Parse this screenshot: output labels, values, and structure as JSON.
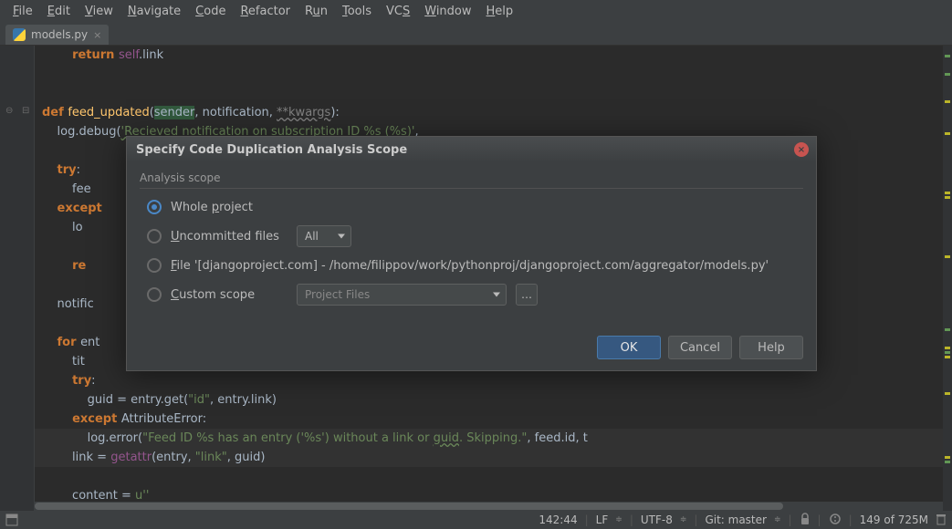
{
  "menu": [
    "File",
    "Edit",
    "View",
    "Navigate",
    "Code",
    "Refactor",
    "Run",
    "Tools",
    "VCS",
    "Window",
    "Help"
  ],
  "menu_accel": [
    0,
    0,
    0,
    0,
    0,
    0,
    1,
    0,
    2,
    0,
    0
  ],
  "tab": {
    "label": "models.py"
  },
  "lines": [
    {
      "i": 8,
      "html": "<span class='k-orange'>return </span><span class='self'>self</span>.link"
    },
    {
      "i": 0,
      "html": ""
    },
    {
      "i": 0,
      "html": ""
    },
    {
      "i": 0,
      "fold": "⊟",
      "caret": "⊖",
      "html": "<span class='k-def'>def </span><span class='name-fn'>feed_updated</span>(<span class='sender-hl'>sender</span>, notification, <span class='pale under-wave'>**kwargs</span>):"
    },
    {
      "i": 4,
      "html": "log.debug(<span class='str under-wave2'>'Recieved notification on subscription ID %s (%s)'</span>,"
    },
    {
      "i": 0,
      "html": ""
    },
    {
      "i": 4,
      "html": "<span class='k-orange'>try</span>:"
    },
    {
      "i": 8,
      "html": "fee"
    },
    {
      "i": 4,
      "html": "<span class='k-orange'>except </span>"
    },
    {
      "i": 8,
      "html": "lo"
    },
    {
      "i": 0,
      "html": ""
    },
    {
      "i": 8,
      "html": "<span class='k-orange'>re</span>"
    },
    {
      "i": 0,
      "html": ""
    },
    {
      "i": 4,
      "html": "notific"
    },
    {
      "i": 0,
      "html": ""
    },
    {
      "i": 4,
      "html": "<span class='k-orange'>for </span>ent"
    },
    {
      "i": 8,
      "html": "tit"
    },
    {
      "i": 8,
      "html": "<span class='k-orange'>try</span>:"
    },
    {
      "i": 12,
      "html": "guid = entry.get(<span class='str'>\"id\"</span>, entry.link)"
    },
    {
      "i": 8,
      "html": "<span class='k-orange'>except </span><span>AttributeError</span>:"
    },
    {
      "i": 12,
      "sel": true,
      "html": "log.error(<span class='str'>\"Feed ID %s has an entry ('%s') without a link or </span><span class='str under-wave2'>guid</span><span class='str'>. Skipping.\"</span>, feed.id, t"
    },
    {
      "i": 8,
      "sel": true,
      "html": "link = <span class='purple'>getattr</span>(entry, <span class='str'>\"link\"</span>, guid)"
    },
    {
      "i": 0,
      "html": ""
    },
    {
      "i": 8,
      "html": "content = <span class='str'>u''</span>"
    }
  ],
  "dialog": {
    "title": "Specify Code Duplication Analysis Scope",
    "group": "Analysis scope",
    "opts": {
      "whole": "Whole project",
      "uncommitted": "Uncommitted files",
      "file": "File '[djangoproject.com] - /home/filippov/work/pythonproj/djangoproject.com/aggregator/models.py'",
      "custom": "Custom scope"
    },
    "uncommitted_combo": "All",
    "custom_combo": "Project Files",
    "buttons": {
      "ok": "OK",
      "cancel": "Cancel",
      "help": "Help"
    }
  },
  "status": {
    "pos": "142:44",
    "le": "LF",
    "enc": "UTF-8",
    "git": "Git: master",
    "mem": "149 of 725M"
  },
  "marks": [
    {
      "t": 10,
      "c": "g"
    },
    {
      "t": 30,
      "c": "g"
    },
    {
      "t": 60,
      "c": "y"
    },
    {
      "t": 95,
      "c": "y"
    },
    {
      "t": 160,
      "c": "y"
    },
    {
      "t": 165,
      "c": "y"
    },
    {
      "t": 230,
      "c": "y"
    },
    {
      "t": 310,
      "c": "g"
    },
    {
      "t": 330,
      "c": "y"
    },
    {
      "t": 335,
      "c": "g"
    },
    {
      "t": 340,
      "c": "y"
    },
    {
      "t": 380,
      "c": "y"
    },
    {
      "t": 450,
      "c": "y"
    },
    {
      "t": 455,
      "c": "g"
    }
  ]
}
